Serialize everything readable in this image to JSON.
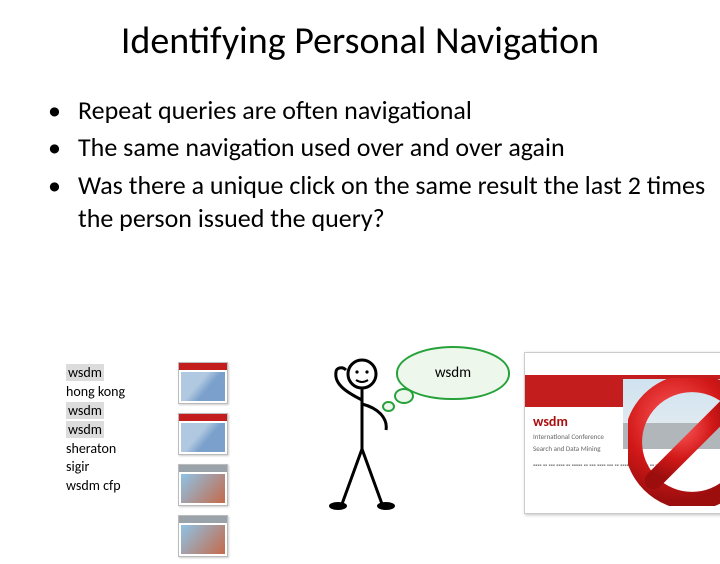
{
  "title": "Identifying Personal Navigation",
  "bullets": [
    "Repeat queries are often navigational",
    "The same navigation used over and over again",
    "Was there a unique click on the same result the last 2 times the person issued the query?"
  ],
  "queries": {
    "items": [
      {
        "text": "wsdm",
        "hl": true
      },
      {
        "text": "hong kong",
        "hl": false
      },
      {
        "text": "wsdm",
        "hl": true
      },
      {
        "text": "wsdm",
        "hl": true
      },
      {
        "text": "sheraton",
        "hl": false
      },
      {
        "text": "sigir",
        "hl": false
      },
      {
        "text": "wsdm cfp",
        "hl": false
      }
    ]
  },
  "thought": "wsdm",
  "screenshot": {
    "line1": "wsdm",
    "line2": "International Conference",
    "line3": "Search and Data Mining"
  }
}
